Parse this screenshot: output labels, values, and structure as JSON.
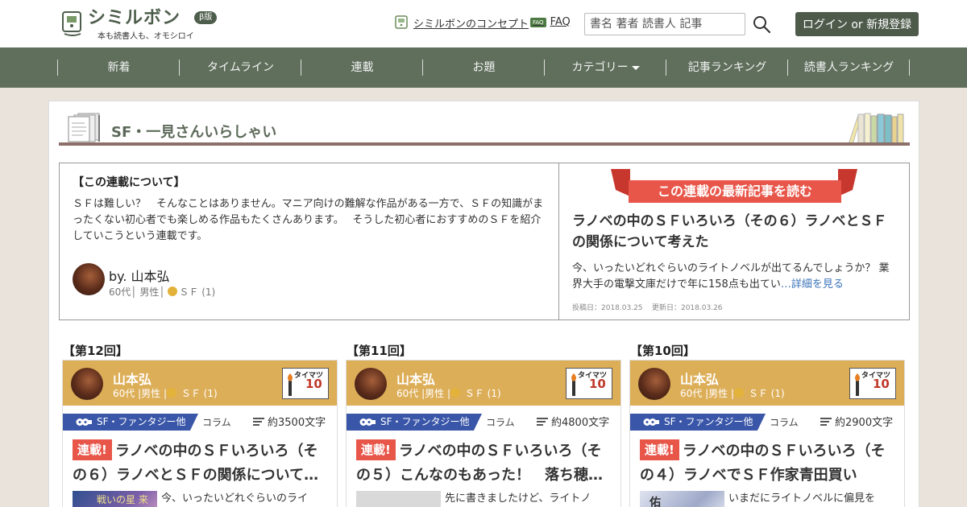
{
  "header": {
    "logo_name": "シミルボン",
    "logo_beta": "β版",
    "logo_tagline": "本も読書人も、オモシロイ",
    "concept_link": "シミルボンのコンセプト",
    "faq_badge": "FAQ",
    "faq_link": "FAQ",
    "search_placeholder": "書名 著者 読書人 記事",
    "login_button": "ログイン or 新規登録"
  },
  "nav": {
    "items": [
      "新着",
      "タイムライン",
      "連載",
      "お題",
      "カテゴリー",
      "記事ランキング",
      "読書人ランキング"
    ]
  },
  "series": {
    "title": "SF・一見さんいらしゃい",
    "about_heading": "【この連載について】",
    "about_body": "ＳＦは難しい？　そんなことはありません。マニア向けの難解な作品がある一方で、ＳＦの知識がまったくない初心者でも楽しめる作品もたくさんあります。　 そうした初心者におすすめのＳＦを紹介していこうという連載です。",
    "author_by": "by. 山本弘",
    "author_age": "60代",
    "author_gender": "男性",
    "author_genre": "ＳＦ (1)"
  },
  "latest": {
    "ribbon": "この連載の最新記事を読む",
    "title": "ラノベの中のＳＦいろいろ（その６）ラノベとＳＦの関係について考えた",
    "body": "今、いったいどれぐらいのライトノベルが出てるんでしょうか？ 業界大手の電撃文庫だけで年に158点も出てい",
    "more": "…詳細を見る",
    "posted": "投稿日：2018.03.25",
    "updated": "更新日：2018.03.26"
  },
  "episodes": [
    {
      "label": "【第12回】",
      "author": "山本弘",
      "age": "60代",
      "gender": "男性",
      "genre": "ＳＦ (1)",
      "torch_label": "タイマツ",
      "torch_lv": "10",
      "category": "SF・ファンタジー他",
      "type": "コラム",
      "chars": "約3500文字",
      "new_badge": "連載!",
      "title": "ラノベの中のＳＦいろいろ（その６）ラノベとＳＦの関係について…",
      "excerpt": "今、いったいどれぐらいのライ",
      "thumb_text": "戦いの星 来"
    },
    {
      "label": "【第11回】",
      "author": "山本弘",
      "age": "60代",
      "gender": "男性",
      "genre": "ＳＦ (1)",
      "torch_label": "タイマツ",
      "torch_lv": "10",
      "category": "SF・ファンタジー他",
      "type": "コラム",
      "chars": "約4800文字",
      "new_badge": "連載!",
      "title": "ラノベの中のＳＦいろいろ（その５）こんなのもあった！　落ち穂…",
      "excerpt": "先に書きましたけど、ライトノ",
      "thumb_text": ""
    },
    {
      "label": "【第10回】",
      "author": "山本弘",
      "age": "60代",
      "gender": "男性",
      "genre": "ＳＦ (1)",
      "torch_label": "タイマツ",
      "torch_lv": "10",
      "category": "SF・ファンタジー他",
      "type": "コラム",
      "chars": "約2900文字",
      "new_badge": "連載!",
      "title": "ラノベの中のＳＦいろいろ（その４）ラノベでＳＦ作家青田買い",
      "excerpt": "いまだにライトノベルに偏見を",
      "thumb_text": "佑"
    }
  ],
  "colors": {
    "brand": "#4e5e4c",
    "nav_bg": "#5f6f5c",
    "card_header": "#ddae58",
    "category_tag": "#3a56a8",
    "accent_red": "#e8564a",
    "link": "#3b73b9"
  }
}
